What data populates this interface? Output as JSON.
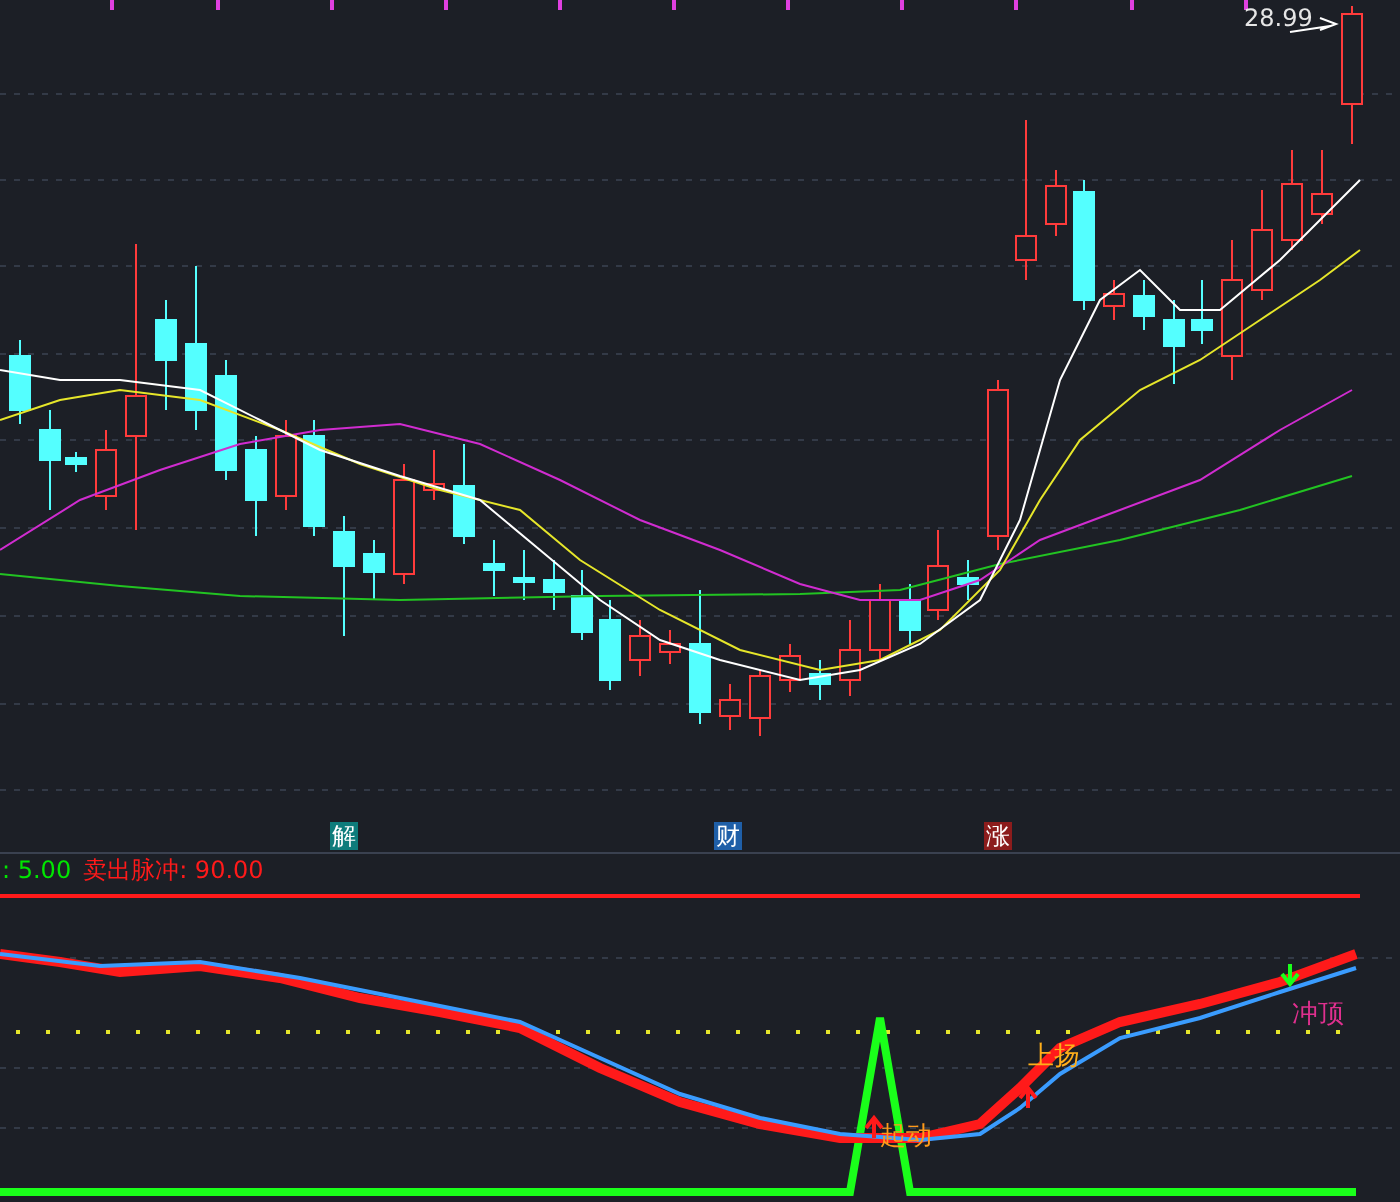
{
  "price_chart": {
    "price_label": "28.99",
    "markers": [
      {
        "text": "解",
        "color": "#0e7c7b"
      },
      {
        "text": "财",
        "color": "#1f5fa8"
      },
      {
        "text": "涨",
        "color": "#8c1c1c"
      }
    ]
  },
  "indicator_panel": {
    "legend": [
      {
        "text": ": 5.00",
        "color": "#00e600"
      },
      {
        "text": "卖出脉冲: 90.00",
        "color": "#ff1a1a"
      }
    ],
    "signals": [
      {
        "text": "起动",
        "kind": "start"
      },
      {
        "text": "上扬",
        "kind": "rise"
      },
      {
        "text": "冲顶",
        "kind": "top"
      }
    ]
  }
}
